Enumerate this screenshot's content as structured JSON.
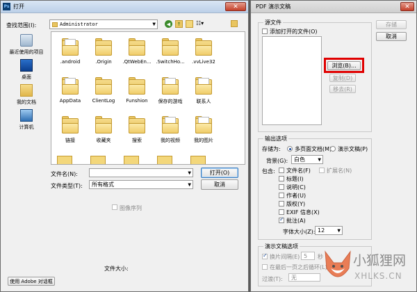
{
  "open_dialog": {
    "title": "打开",
    "lookin_label": "查找范围(I):",
    "lookin_value": "Administrator",
    "nav": [
      {
        "label": "最近使用的项目",
        "icon": "recent-items-icon"
      },
      {
        "label": "桌面",
        "icon": "desktop-icon"
      },
      {
        "label": "我的文档",
        "icon": "documents-icon"
      },
      {
        "label": "计算机",
        "icon": "computer-icon"
      }
    ],
    "files": [
      ".android",
      ".Origin",
      ".QtWebEn...",
      ".SwitchHo...",
      ".vvLive32",
      "AppData",
      "ClientLog",
      "Funshion",
      "保存的游戏",
      "联系人",
      "链接",
      "收藏夹",
      "搜索",
      "我的视频",
      "我的图片"
    ],
    "filename_label": "文件名(N):",
    "filename_value": "",
    "filetype_label": "文件类型(T):",
    "filetype_value": "所有格式",
    "open_button": "打开(O)",
    "cancel_button": "取消",
    "image_sequence_label": "图像序列",
    "file_size_label": "文件大小:",
    "adobe_button": "使用 Adobe 对话框"
  },
  "pdf_dialog": {
    "title": "PDF 演示文稿",
    "source_group": "源文件",
    "add_open_files": "添加打开的文件(O)",
    "browse_button": "浏览(B)...",
    "duplicate_button": "复制(D)",
    "remove_button": "移去(R)",
    "save_button": "存储",
    "cancel_button": "取消",
    "output_group": "输出选项",
    "save_as_label": "存储为:",
    "multi_page": "多页面文档(M)",
    "presentation": "演示文稿(P)",
    "background_label": "背景(G):",
    "background_value": "白色",
    "include_label": "包含:",
    "options": [
      {
        "label": "文件名(F)",
        "checked": false
      },
      {
        "label": "扩展名(N)",
        "checked": false,
        "disabled": true
      },
      {
        "label": "标题(I)",
        "checked": false
      },
      {
        "label": "说明(C)",
        "checked": false
      },
      {
        "label": "作者(U)",
        "checked": false
      },
      {
        "label": "版权(Y)",
        "checked": false
      },
      {
        "label": "EXIF 信息(X)",
        "checked": false
      },
      {
        "label": "批注(A)",
        "checked": true
      }
    ],
    "font_size_label": "字体大小(Z):",
    "font_size_value": "12",
    "presentation_group": "演示文稿选项",
    "advance_every": "换片间隔(E)",
    "advance_seconds": "5",
    "seconds_unit": "秒",
    "loop_after_last": "在最后一页之后循环(L)",
    "transition_label": "过渡(T):",
    "transition_value": "无"
  },
  "watermark": {
    "title": "小狐狸网",
    "url": "XHLKS.CN"
  },
  "highlight_color": "#e00000"
}
